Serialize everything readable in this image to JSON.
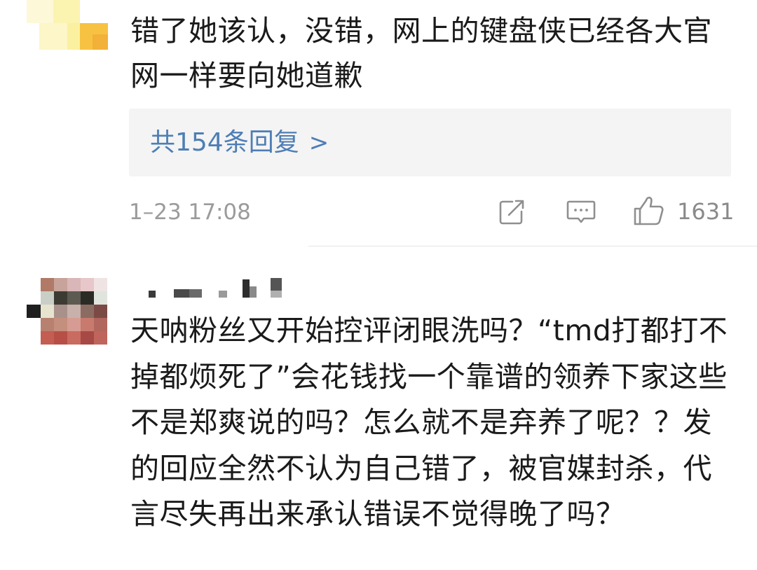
{
  "comments": [
    {
      "text": "错了她该认，没错，网上的键盘侠已经各大官网一样要向她道歉",
      "replies_label": "共154条回复",
      "replies_chevron": ">",
      "timestamp": "1–23 17:08",
      "like_count": "1631",
      "actions": {
        "repost_icon": "share-edit-icon",
        "comment_icon": "comment-bubble-icon",
        "like_icon": "thumbs-up-icon"
      }
    },
    {
      "text": "天呐粉丝又开始控评闭眼洗吗？“tmd打都打不掉都烦死了”会花钱找一个靠谱的领养下家这些不是郑爽说的吗？怎么就不是弃养了呢？？发的回应全然不认为自己错了，被官媒封杀，代言尽失再出来承认错误不觉得晚了吗？"
    }
  ],
  "colors": {
    "link_blue": "#4e7eb5",
    "meta_gray": "#9b9b9b",
    "reply_bg": "#f4f4f4"
  }
}
